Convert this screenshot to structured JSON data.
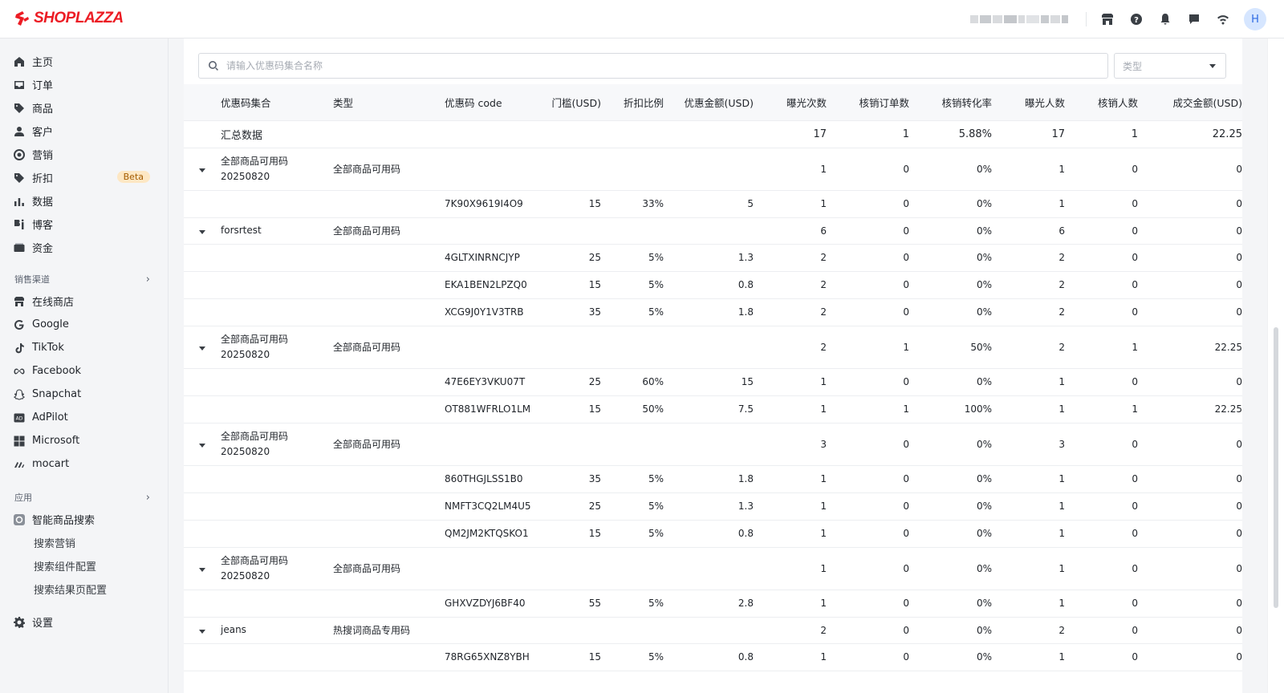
{
  "brand": {
    "name": "SHOPLAZZA",
    "color": "#ec1c24"
  },
  "topbar": {
    "icons": [
      "store-icon",
      "help-icon",
      "bell-icon",
      "message-icon",
      "wifi-icon"
    ],
    "avatar_letter": "H"
  },
  "sidebar": {
    "main_items": [
      {
        "label": "主页",
        "icon": "home-icon"
      },
      {
        "label": "订单",
        "icon": "inbox-icon"
      },
      {
        "label": "商品",
        "icon": "tag-icon"
      },
      {
        "label": "客户",
        "icon": "user-icon"
      },
      {
        "label": "营销",
        "icon": "target-icon"
      },
      {
        "label": "折扣",
        "icon": "discount-tag-icon",
        "badge": "Beta"
      },
      {
        "label": "数据",
        "icon": "chart-icon"
      },
      {
        "label": "博客",
        "icon": "blog-icon"
      },
      {
        "label": "资金",
        "icon": "wallet-icon"
      }
    ],
    "sales_channels_title": "销售渠道",
    "channels": [
      {
        "label": "在线商店",
        "icon": "store-icon"
      },
      {
        "label": "Google",
        "icon": "google-icon"
      },
      {
        "label": "TikTok",
        "icon": "tiktok-icon"
      },
      {
        "label": "Facebook",
        "icon": "meta-icon"
      },
      {
        "label": "Snapchat",
        "icon": "snapchat-icon"
      },
      {
        "label": "AdPilot",
        "icon": "adpilot-icon"
      },
      {
        "label": "Microsoft",
        "icon": "microsoft-icon"
      },
      {
        "label": "mocart",
        "icon": "mocart-icon"
      }
    ],
    "apps_title": "应用",
    "app": {
      "label": "智能商品搜索",
      "icon": "smart-search-icon"
    },
    "app_sub_items": [
      "搜索营销",
      "搜索组件配置",
      "搜索结果页配置"
    ],
    "settings": {
      "label": "设置",
      "icon": "gear-icon"
    }
  },
  "filters": {
    "search_placeholder": "请输入优惠码集合名称",
    "type_placeholder": "类型"
  },
  "table": {
    "headers": {
      "name": "优惠码集合",
      "type": "类型",
      "code": "优惠码 code",
      "threshold": "门槛(USD)",
      "discount": "折扣比例",
      "amount": "优惠金额(USD)",
      "exposure": "曝光次数",
      "orders": "核销订单数",
      "conversion": "核销转化率",
      "exposed_users": "曝光人数",
      "redeemed_users": "核销人数",
      "revenue": "成交金额(USD)"
    },
    "summary": {
      "label": "汇总数据",
      "exposure": "17",
      "orders": "1",
      "conversion": "5.88%",
      "exposed_users": "17",
      "redeemed_users": "1",
      "revenue": "22.25"
    },
    "rows": [
      {
        "kind": "parent",
        "name": "全部商品可用码 20250820",
        "type": "全部商品可用码",
        "exposure": "1",
        "orders": "0",
        "conversion": "0%",
        "exposed_users": "1",
        "redeemed_users": "0",
        "revenue": "0"
      },
      {
        "kind": "child",
        "code": "7K90X9619I4O9",
        "threshold": "15",
        "discount": "33%",
        "amount": "5",
        "exposure": "1",
        "orders": "0",
        "conversion": "0%",
        "exposed_users": "1",
        "redeemed_users": "0",
        "revenue": "0"
      },
      {
        "kind": "parent",
        "name": "forsrtest",
        "type": "全部商品可用码",
        "exposure": "6",
        "orders": "0",
        "conversion": "0%",
        "exposed_users": "6",
        "redeemed_users": "0",
        "revenue": "0"
      },
      {
        "kind": "child",
        "code": "4GLTXINRNCJYP",
        "threshold": "25",
        "discount": "5%",
        "amount": "1.3",
        "exposure": "2",
        "orders": "0",
        "conversion": "0%",
        "exposed_users": "2",
        "redeemed_users": "0",
        "revenue": "0"
      },
      {
        "kind": "child",
        "code": "EKA1BEN2LPZQ0",
        "threshold": "15",
        "discount": "5%",
        "amount": "0.8",
        "exposure": "2",
        "orders": "0",
        "conversion": "0%",
        "exposed_users": "2",
        "redeemed_users": "0",
        "revenue": "0"
      },
      {
        "kind": "child",
        "code": "XCG9J0Y1V3TRB",
        "threshold": "35",
        "discount": "5%",
        "amount": "1.8",
        "exposure": "2",
        "orders": "0",
        "conversion": "0%",
        "exposed_users": "2",
        "redeemed_users": "0",
        "revenue": "0"
      },
      {
        "kind": "parent",
        "name": "全部商品可用码 20250820",
        "type": "全部商品可用码",
        "exposure": "2",
        "orders": "1",
        "conversion": "50%",
        "exposed_users": "2",
        "redeemed_users": "1",
        "revenue": "22.25"
      },
      {
        "kind": "child",
        "code": "47E6EY3VKU07T",
        "threshold": "25",
        "discount": "60%",
        "amount": "15",
        "exposure": "1",
        "orders": "0",
        "conversion": "0%",
        "exposed_users": "1",
        "redeemed_users": "0",
        "revenue": "0"
      },
      {
        "kind": "child",
        "code": "OT881WFRLO1LM",
        "threshold": "15",
        "discount": "50%",
        "amount": "7.5",
        "exposure": "1",
        "orders": "1",
        "conversion": "100%",
        "exposed_users": "1",
        "redeemed_users": "1",
        "revenue": "22.25"
      },
      {
        "kind": "parent",
        "name": "全部商品可用码 20250820",
        "type": "全部商品可用码",
        "exposure": "3",
        "orders": "0",
        "conversion": "0%",
        "exposed_users": "3",
        "redeemed_users": "0",
        "revenue": "0"
      },
      {
        "kind": "child",
        "code": "860THGJLSS1B0",
        "threshold": "35",
        "discount": "5%",
        "amount": "1.8",
        "exposure": "1",
        "orders": "0",
        "conversion": "0%",
        "exposed_users": "1",
        "redeemed_users": "0",
        "revenue": "0"
      },
      {
        "kind": "child",
        "code": "NMFT3CQ2LM4U5",
        "threshold": "25",
        "discount": "5%",
        "amount": "1.3",
        "exposure": "1",
        "orders": "0",
        "conversion": "0%",
        "exposed_users": "1",
        "redeemed_users": "0",
        "revenue": "0"
      },
      {
        "kind": "child",
        "code": "QM2JM2KTQSKO1",
        "threshold": "15",
        "discount": "5%",
        "amount": "0.8",
        "exposure": "1",
        "orders": "0",
        "conversion": "0%",
        "exposed_users": "1",
        "redeemed_users": "0",
        "revenue": "0"
      },
      {
        "kind": "parent",
        "name": "全部商品可用码 20250820",
        "type": "全部商品可用码",
        "exposure": "1",
        "orders": "0",
        "conversion": "0%",
        "exposed_users": "1",
        "redeemed_users": "0",
        "revenue": "0"
      },
      {
        "kind": "child",
        "code": "GHXVZDYJ6BF40",
        "threshold": "55",
        "discount": "5%",
        "amount": "2.8",
        "exposure": "1",
        "orders": "0",
        "conversion": "0%",
        "exposed_users": "1",
        "redeemed_users": "0",
        "revenue": "0"
      },
      {
        "kind": "parent",
        "name": "jeans",
        "type": "热搜词商品专用码",
        "exposure": "2",
        "orders": "0",
        "conversion": "0%",
        "exposed_users": "2",
        "redeemed_users": "0",
        "revenue": "0"
      },
      {
        "kind": "child",
        "code": "78RG65XNZ8YBH",
        "threshold": "15",
        "discount": "5%",
        "amount": "0.8",
        "exposure": "1",
        "orders": "0",
        "conversion": "0%",
        "exposed_users": "1",
        "redeemed_users": "0",
        "revenue": "0"
      }
    ]
  }
}
